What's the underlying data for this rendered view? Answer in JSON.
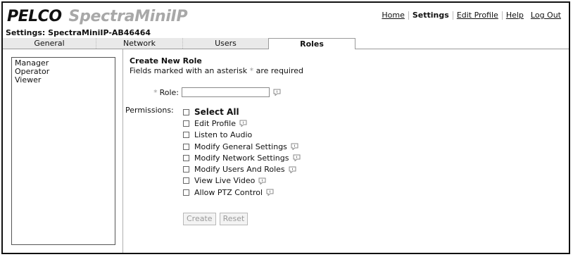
{
  "header": {
    "brand": "PELCO",
    "product": "SpectraMiniIP",
    "nav": [
      {
        "label": "Home",
        "active": false
      },
      {
        "label": "Settings",
        "active": true
      },
      {
        "label": "Edit Profile",
        "active": false
      },
      {
        "label": "Help",
        "active": false
      },
      {
        "label": "Log Out",
        "active": false
      }
    ]
  },
  "settings_title": "Settings: SpectraMiniIP-AB46464",
  "tabs": [
    {
      "label": "General",
      "active": false
    },
    {
      "label": "Network",
      "active": false
    },
    {
      "label": "Users",
      "active": false
    },
    {
      "label": "Roles",
      "active": true
    }
  ],
  "roles": [
    "Manager",
    "Operator",
    "Viewer"
  ],
  "form": {
    "title": "Create New Role",
    "required_note_prefix": "Fields marked with an asterisk",
    "required_note_suffix": "are required",
    "asterisk": "*",
    "role_label": "Role:",
    "role_value": "",
    "permissions_label": "Permissions:",
    "permissions": [
      {
        "label": "Select All",
        "bold": true,
        "help": false,
        "checked": false
      },
      {
        "label": "Edit Profile",
        "bold": false,
        "help": true,
        "checked": false
      },
      {
        "label": "Listen to Audio",
        "bold": false,
        "help": false,
        "checked": false
      },
      {
        "label": "Modify General Settings",
        "bold": false,
        "help": true,
        "checked": false
      },
      {
        "label": "Modify Network Settings",
        "bold": false,
        "help": true,
        "checked": false
      },
      {
        "label": "Modify Users And Roles",
        "bold": false,
        "help": true,
        "checked": false
      },
      {
        "label": "View Live Video",
        "bold": false,
        "help": true,
        "checked": false
      },
      {
        "label": "Allow PTZ Control",
        "bold": false,
        "help": true,
        "checked": false
      }
    ],
    "create_label": "Create",
    "reset_label": "Reset"
  },
  "icons": {
    "help": "help-balloon-icon"
  },
  "colors": {
    "frame": "#111111",
    "tab_bg": "#e9e9e9",
    "muted": "#a8a8a8"
  }
}
